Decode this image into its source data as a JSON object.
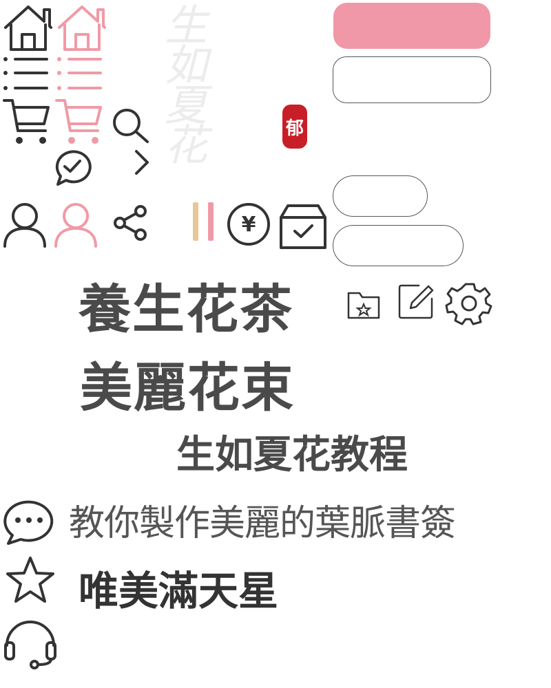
{
  "decor": {
    "ghost_text": "生如夏花",
    "seal_char": "郁"
  },
  "price_icon": {
    "symbol": "¥"
  },
  "headings": {
    "line1": "養生花茶",
    "line2": "美麗花束",
    "line3": "生如夏花教程"
  },
  "rows": {
    "chat_text": "教你製作美麗的葉脈書簽",
    "star_text": "唯美滿天星"
  },
  "colors": {
    "pink": "#f09aa6",
    "dark": "#333333",
    "seal_red": "#c81e28",
    "tan": "#e6c896"
  },
  "icons": [
    "home-icon",
    "home-icon-pink",
    "list-icon",
    "list-icon-pink",
    "cart-icon",
    "cart-icon-pink",
    "search-icon",
    "check-bubble-icon",
    "chevron-right-icon",
    "user-icon",
    "user-icon-pink",
    "share-icon",
    "yen-icon",
    "box-check-icon",
    "folder-star-icon",
    "edit-icon",
    "gear-icon",
    "chat-icon",
    "star-icon",
    "headset-icon"
  ]
}
